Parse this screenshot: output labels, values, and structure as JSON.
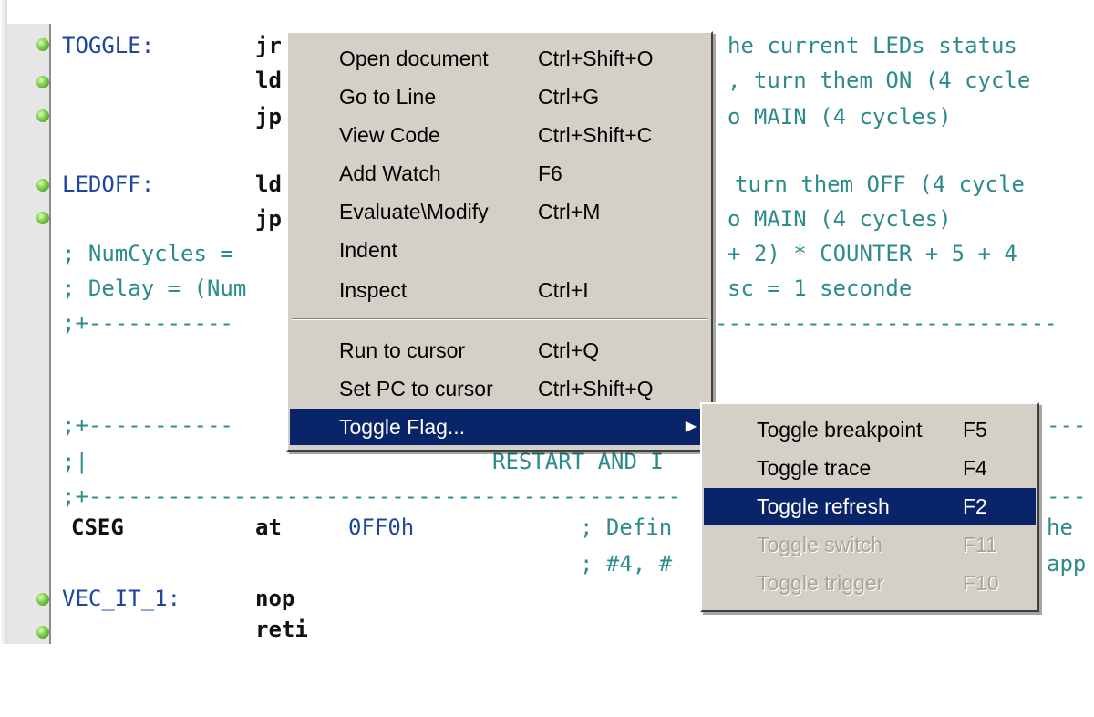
{
  "code": {
    "lines": [
      {
        "label": "TOGGLE:",
        "instr": "jr",
        "comment_right": "he current LEDs status"
      },
      {
        "instr": "ld",
        "comment_right": ", turn them ON (4 cycle"
      },
      {
        "instr": "jp",
        "comment_right": "o MAIN (4 cycles)"
      },
      {
        "label": "LEDOFF:",
        "instr": "ld",
        "comment_right": "turn them OFF (4 cycle"
      },
      {
        "instr": "jp",
        "comment_right": "o MAIN (4 cycles)"
      },
      {
        "comment_left": "; NumCycles =",
        "comment_right": "+ 2) * COUNTER + 5 + 4"
      },
      {
        "comment_left": "; Delay = (Num",
        "comment_right": "sc = 1 seconde"
      },
      {
        "comment_left": ";+-----------",
        "comment_right": "--------------------------"
      },
      {
        "comment_left": ";+-----------",
        "comment_right": "---"
      },
      {
        "comment_left": ";|",
        "comment_mid": "RESTART AND I"
      },
      {
        "comment_left": ";+---------------------------------------------",
        "comment_right": "---"
      },
      {
        "label": "CSEG",
        "instr": "at",
        "operand": "0FF0h",
        "comment_mid": "; Defin",
        "comment_right": "he"
      },
      {
        "comment_mid": "; #4, #",
        "comment_right": "app"
      },
      {
        "label": "VEC_IT_1:",
        "instr": "nop"
      },
      {
        "instr": "reti"
      }
    ]
  },
  "context_menu": {
    "items": [
      {
        "label": "Open document",
        "shortcut": "Ctrl+Shift+O"
      },
      {
        "label": "Go to Line",
        "shortcut": "Ctrl+G"
      },
      {
        "label": "View Code",
        "shortcut": "Ctrl+Shift+C"
      },
      {
        "label": "Add Watch",
        "shortcut": "F6"
      },
      {
        "label": "Evaluate\\Modify",
        "shortcut": "Ctrl+M"
      },
      {
        "label": "Indent",
        "shortcut": ""
      },
      {
        "label": "Inspect",
        "shortcut": "Ctrl+I"
      },
      {
        "label": "Run to cursor",
        "shortcut": "Ctrl+Q"
      },
      {
        "label": "Set PC to cursor",
        "shortcut": "Ctrl+Shift+Q"
      },
      {
        "label": "Toggle Flag...",
        "shortcut": "",
        "submenu": true
      }
    ]
  },
  "submenu": {
    "items": [
      {
        "label": "Toggle breakpoint",
        "shortcut": "F5"
      },
      {
        "label": "Toggle trace",
        "shortcut": "F4"
      },
      {
        "label": "Toggle refresh",
        "shortcut": "F2"
      },
      {
        "label": "Toggle switch",
        "shortcut": "F11"
      },
      {
        "label": "Toggle trigger",
        "shortcut": "F10"
      }
    ]
  },
  "colors": {
    "highlight": "#0a246a",
    "menu_bg": "#d4d0c8",
    "comment": "#2e8b8b",
    "label": "#1e46a0"
  }
}
